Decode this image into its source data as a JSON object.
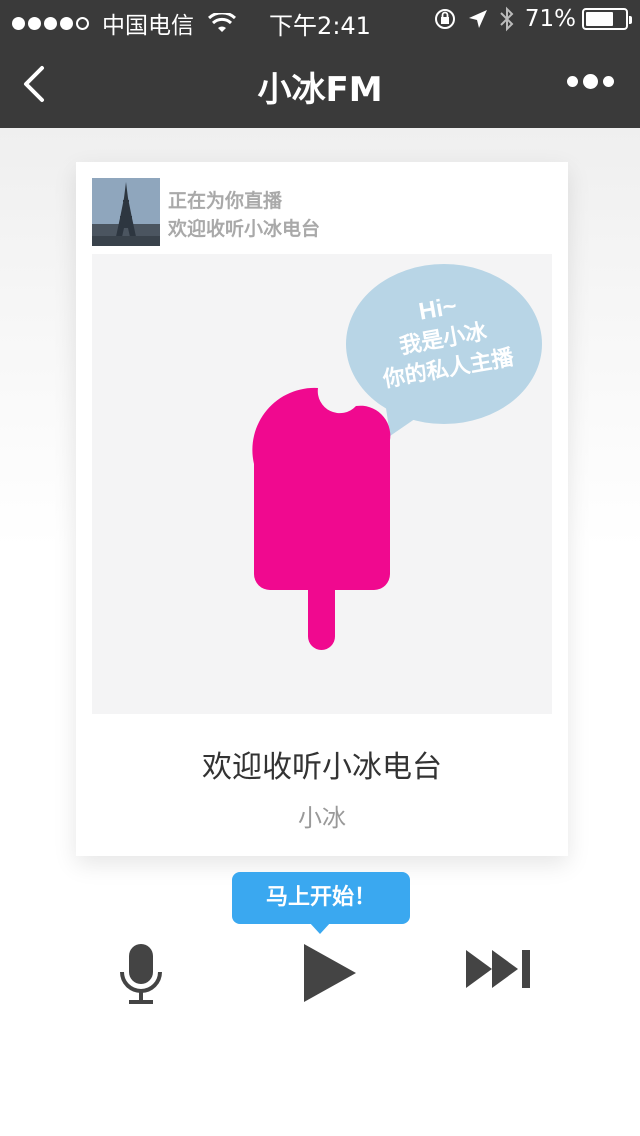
{
  "status_bar": {
    "carrier": "中国电信",
    "time": "下午2:41",
    "battery_percent": "71%",
    "battery_level": 0.71,
    "signal_bars": 4
  },
  "nav": {
    "title": "小冰FM",
    "back_icon": "chevron-left-icon",
    "more_icon": "more-dots-icon"
  },
  "card": {
    "live_line1": "正在为你直播",
    "live_line2": "欢迎收听小冰电台",
    "bubble_line1": "Hi~",
    "bubble_line2": "我是小冰",
    "bubble_line3": "你的私人主播",
    "song_title": "欢迎收听小冰电台",
    "artist": "小冰"
  },
  "tooltip": {
    "label": "马上开始！"
  },
  "controls": {
    "mic_icon": "microphone-icon",
    "play_icon": "play-icon",
    "next_icon": "skip-next-icon"
  },
  "colors": {
    "nav_bg": "#3a3a3a",
    "popsicle": "#f0098f",
    "bubble": "#b8d5e6",
    "tooltip": "#3aa8f0",
    "control": "#444444"
  }
}
